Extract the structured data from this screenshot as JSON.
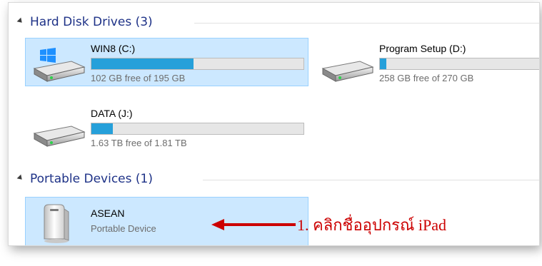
{
  "groups": {
    "hard_disk": {
      "title": "Hard Disk Drives (3)"
    },
    "portable": {
      "title": "Portable Devices (1)"
    }
  },
  "drives": [
    {
      "name": "WIN8 (C:)",
      "free_text": "102 GB free of 195 GB",
      "used_fraction": 0.48,
      "selected": true,
      "icon": "windows-drive-icon"
    },
    {
      "name": "Program Setup (D:)",
      "free_text": "258 GB free of 270 GB",
      "used_fraction": 0.04,
      "selected": false,
      "icon": "hard-drive-icon"
    },
    {
      "name": "DATA (J:)",
      "free_text": "1.63 TB free of 1.81 TB",
      "used_fraction": 0.1,
      "selected": false,
      "icon": "hard-drive-icon"
    }
  ],
  "devices": [
    {
      "name": "ASEAN",
      "type": "Portable Device",
      "selected": true,
      "icon": "portable-device-icon"
    }
  ],
  "annotation": {
    "text": "1. คลิกชื่ออุปกรณ์ iPad",
    "color": "#cc0000"
  },
  "colors": {
    "accent_header": "#1e3287",
    "bar_fill": "#26a0da",
    "selection_bg": "#cce8ff",
    "selection_border": "#99d1ff"
  }
}
